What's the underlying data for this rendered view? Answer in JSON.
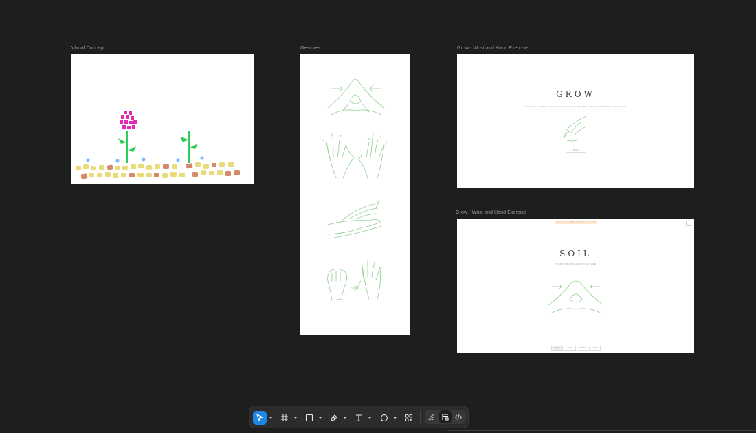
{
  "frames": {
    "visual_concept": {
      "label": "Visual Concept"
    },
    "gestures": {
      "label": "Gestures"
    },
    "grow": {
      "label": "Grow - Wrist and Hand Exercise",
      "title": "GROW",
      "subtitle": "ONE HAND OVER THE OTHER, GENTLY LIFT THE FINGERS UPWARDS TO GROW",
      "button": "BEGIN"
    },
    "soil": {
      "label": "Grow - Wrist and Hand Exercise",
      "title": "SOIL",
      "subtitle": "PRESS YOUR PALMS TOGETHER",
      "banner": "PRESS YOUR PALMS TOGETHER TO FORM THE SEED",
      "tabs": [
        "SOIL",
        "SEED",
        "SPROUT",
        "GROW"
      ]
    }
  },
  "toolbar": {
    "tools": [
      {
        "name": "move-tool",
        "icon": "cursor-icon",
        "active": true
      },
      {
        "name": "frame-tool",
        "icon": "hash-icon",
        "active": false
      },
      {
        "name": "shape-tool",
        "icon": "rectangle-icon",
        "active": false
      },
      {
        "name": "pen-tool",
        "icon": "pen-icon",
        "active": false
      },
      {
        "name": "text-tool",
        "icon": "text-icon",
        "active": false
      },
      {
        "name": "comment-tool",
        "icon": "comment-icon",
        "active": false
      },
      {
        "name": "actions-tool",
        "icon": "components-icon",
        "active": false
      }
    ],
    "modes": [
      {
        "name": "draw-mode",
        "icon": "draw-icon",
        "active": false
      },
      {
        "name": "design-mode",
        "icon": "design-icon",
        "active": true
      },
      {
        "name": "dev-mode",
        "icon": "code-icon",
        "active": false
      }
    ],
    "colors": {
      "accent": "#1e88e5",
      "bg": "#2c2c2c"
    }
  },
  "canvas": {
    "background": "#1e1e1e"
  }
}
